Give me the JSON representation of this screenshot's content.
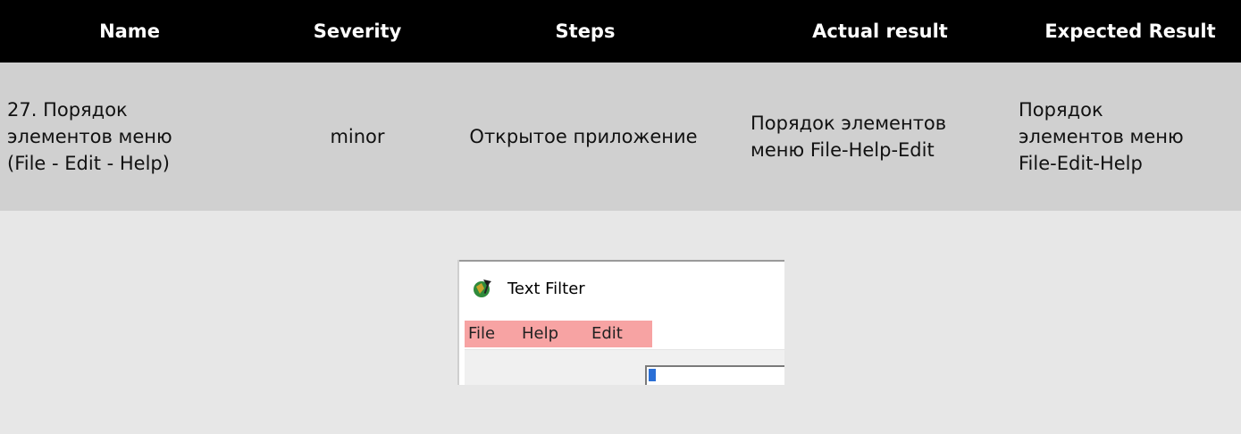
{
  "table": {
    "headers": {
      "name": "Name",
      "severity": "Severity",
      "steps": "Steps",
      "actual": "Actual result",
      "expected": "Expected Result"
    },
    "row": {
      "name_lines": [
        "27. Порядок",
        "элементов меню",
        "(File - Edit - Help)"
      ],
      "severity": "minor",
      "steps": "Открытое приложение",
      "actual_lines": [
        "Порядок элементов",
        "меню File-Help-Edit"
      ],
      "expected_lines": [
        "Порядок",
        "элементов меню",
        "File-Edit-Help"
      ]
    }
  },
  "screenshot": {
    "window_title": "Text Filter",
    "app_icon": "app-icon",
    "menu": [
      "File",
      "Help",
      "Edit"
    ],
    "highlight_color": "#f7a3a3"
  },
  "colors": {
    "header_bg": "#000000",
    "row_bg": "#d0d0d0",
    "image_row_bg": "#e7e7e7"
  }
}
